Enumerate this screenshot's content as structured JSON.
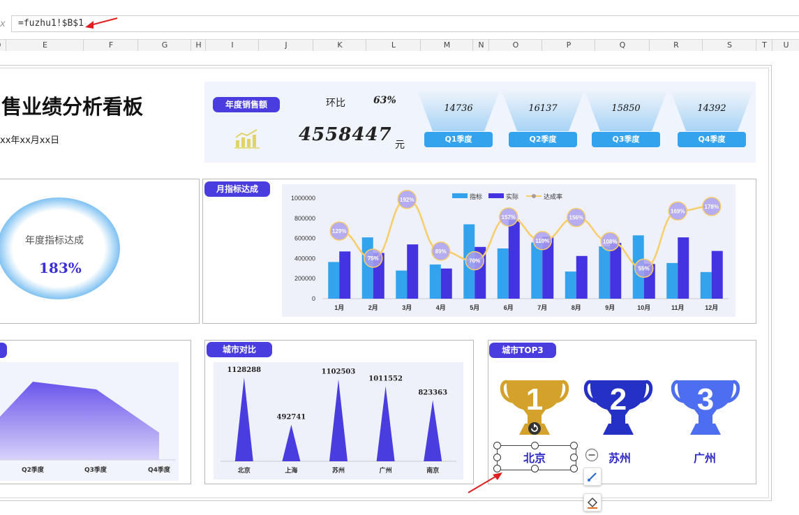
{
  "formula": {
    "fx_label": "x",
    "value": "=fuzhu1!$B$1"
  },
  "columns": [
    "D",
    "E",
    "F",
    "G",
    "H",
    "I",
    "J",
    "K",
    "L",
    "M",
    "N",
    "O",
    "P",
    "Q",
    "R",
    "S",
    "T",
    "U"
  ],
  "dashboard": {
    "title": "售业绩分析看板",
    "date": "xx年xx月xx日",
    "annual_sales_label": "年度销售额",
    "mom_label": "环比",
    "mom_value": "63%",
    "annual_sales_value": "4558447",
    "currency": "元",
    "quarters": [
      {
        "label": "Q1季度",
        "value": "14736"
      },
      {
        "label": "Q2季度",
        "value": "16137"
      },
      {
        "label": "Q3季度",
        "value": "15850"
      },
      {
        "label": "Q4季度",
        "value": "14392"
      }
    ],
    "target_label": "年度指标达成",
    "target_value": "183%",
    "monthly_title": "月指标达成",
    "city_compare_title": "城市对比",
    "top3_title": "城市TOP3",
    "top3": [
      {
        "rank": "1",
        "city": "北京",
        "color": "#d4a12a"
      },
      {
        "rank": "2",
        "city": "苏州",
        "color": "#2531c4"
      },
      {
        "rank": "3",
        "city": "广州",
        "color": "#4d6ef0"
      }
    ],
    "quarter_area_labels": [
      "Q2季度",
      "Q3季度",
      "Q4季度"
    ]
  },
  "chart_data": [
    {
      "type": "bar",
      "categories": [
        "1月",
        "2月",
        "3月",
        "4月",
        "5月",
        "6月",
        "7月",
        "8月",
        "9月",
        "10月",
        "11月",
        "12月"
      ],
      "series": [
        {
          "name": "指标",
          "values": [
            365000,
            610000,
            280000,
            340000,
            740000,
            500000,
            560000,
            270000,
            520000,
            630000,
            355000,
            265000
          ],
          "color": "#33a3ee"
        },
        {
          "name": "实际",
          "values": [
            470000,
            455000,
            540000,
            300000,
            515000,
            785000,
            615000,
            425000,
            555000,
            345000,
            610000,
            475000
          ],
          "color": "#4433e0"
        },
        {
          "name": "达成率",
          "values": [
            "129%",
            "75%",
            "192%",
            "89%",
            "70%",
            "157%",
            "110%",
            "156%",
            "108%",
            "55%",
            "169%",
            "178%"
          ],
          "color": "#f7cd6a"
        }
      ],
      "yticks": [
        "0",
        "200000",
        "400000",
        "600000",
        "800000",
        "1000000"
      ],
      "ylim": [
        0,
        1000000
      ]
    },
    {
      "type": "bar",
      "categories": [
        "北京",
        "上海",
        "苏州",
        "广州",
        "南京"
      ],
      "values": [
        1128288,
        492741,
        1102503,
        1011552,
        823363
      ],
      "color": "#4a3de0"
    }
  ]
}
